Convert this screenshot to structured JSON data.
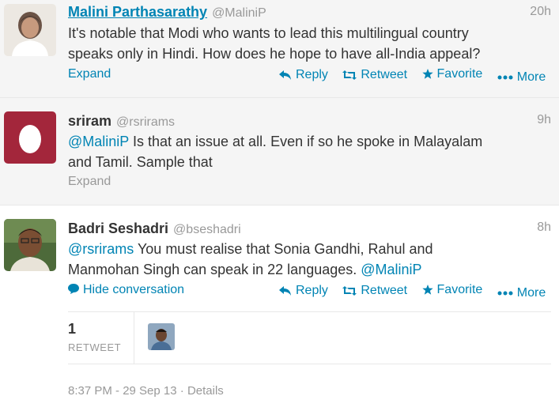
{
  "tweets": [
    {
      "name": "Malini Parthasarathy",
      "handle": "@MaliniP",
      "time": "20h",
      "text_line1": "It's notable that Modi who wants to lead this multilingual country",
      "text_line2": "speaks only in Hindi. How does he hope to have all-India appeal?",
      "expand": "Expand"
    },
    {
      "name": "sriram",
      "handle": "@rsrirams",
      "time": "9h",
      "mention": "@MaliniP",
      "text_line1_rest": " Is that an issue at all. Even if so he spoke in Malayalam",
      "text_line2": "and Tamil. Sample that",
      "expand": "Expand"
    },
    {
      "name": "Badri Seshadri",
      "handle": "@bseshadri",
      "time": "8h",
      "mention": "@rsrirams",
      "text_line1_rest": " You must realise that Sonia Gandhi, Rahul and",
      "text_line2": "Manmohan Singh can speak in 22 languages. ",
      "mention2": "@MaliniP",
      "hide_conversation": "Hide conversation",
      "retweet_count": "1",
      "retweet_label": "RETWEET",
      "timestamp": "8:37 PM - 29 Sep 13",
      "separator": " · ",
      "details": "Details"
    }
  ],
  "actions": {
    "reply": "Reply",
    "retweet": "Retweet",
    "favorite": "Favorite",
    "more": "More"
  },
  "colors": {
    "link": "#0084b4",
    "muted": "#999999",
    "text": "#333333",
    "egg_bg": "#a3263b"
  }
}
